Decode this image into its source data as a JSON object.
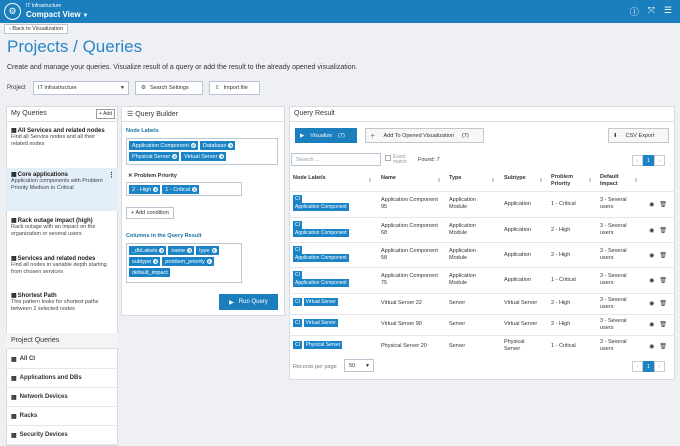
{
  "app": {
    "subtitle": "IT Infrastructure",
    "title": "Compact View"
  },
  "back_label": "Back to Visualization",
  "page": {
    "title": "Projects / Queries",
    "description": "Create and manage your queries. Visualize result of a query or add the result to the already opened visualization."
  },
  "project": {
    "label": "Project",
    "value": "IT Infrastructure",
    "search_settings": "Search Settings",
    "import_file": "Import file"
  },
  "my_queries": {
    "title": "My Queries",
    "add": "Add",
    "items": [
      {
        "name": "All Services and related nodes",
        "desc": "Find all Service nodes and all their related nodes"
      },
      {
        "name": "Core applications",
        "desc": "Application components with Problem Priority Medium to Critical"
      },
      {
        "name": "Rack outage impact (high)",
        "desc": "Rack outage with an impact on the organization or several users"
      },
      {
        "name": "Services and related nodes",
        "desc": "Find all nodes in variable depth starting from chosen services"
      },
      {
        "name": "Shortest Path",
        "desc": "This pattern looks for shortest paths between 2 selected nodes"
      }
    ]
  },
  "project_queries": {
    "title": "Project Queries",
    "items": [
      "All CI",
      "Applications and DBs",
      "Network Devices",
      "Racks",
      "Security Devices"
    ]
  },
  "builder": {
    "title": "Query Builder",
    "node_labels_title": "Node Labels",
    "node_labels": [
      "Application Component",
      "Database",
      "Physical Server",
      "Virtual Server"
    ],
    "problem_priority_title": "Problem Priority",
    "priorities": [
      "2 - High",
      "1 - Critical"
    ],
    "add_condition": "Add condition",
    "columns_title": "Columns in the Query Result",
    "columns": [
      "_dbLabels",
      "name",
      "type",
      "subtype",
      "problem_priority",
      "default_impact"
    ],
    "run": "Run Query"
  },
  "result": {
    "title": "Query Result",
    "visualize": "Visualize",
    "visualize_count": "(7)",
    "add_to_viz": "Add To Opened Visualization",
    "add_count": "(7)",
    "csv": "CSV Export",
    "search_placeholder": "Search ...",
    "exact": "Exact match",
    "found": "Found: 7",
    "page": "1",
    "columns": [
      "Node Labels",
      "Name",
      "Type",
      "Subtype",
      "Problem Priority",
      "Default Impact"
    ],
    "rows": [
      {
        "labels": [
          "CI",
          "Application Component"
        ],
        "name": "Application Component 95",
        "type": "Application Module",
        "subtype": "Application",
        "priority": "1 - Critical",
        "impact": "3 - Several users"
      },
      {
        "labels": [
          "CI",
          "Application Component"
        ],
        "name": "Application Component 68",
        "type": "Application Module",
        "subtype": "Application",
        "priority": "2 - High",
        "impact": "3 - Several users"
      },
      {
        "labels": [
          "CI",
          "Application Component"
        ],
        "name": "Application Component 58",
        "type": "Application Module",
        "subtype": "Application",
        "priority": "2 - High",
        "impact": "3 - Several users"
      },
      {
        "labels": [
          "CI",
          "Application Component"
        ],
        "name": "Application Component 75",
        "type": "Application Module",
        "subtype": "Application",
        "priority": "1 - Critical",
        "impact": "3 - Several users"
      },
      {
        "labels": [
          "CI",
          "Virtual Server"
        ],
        "name": "Virtual Server 22",
        "type": "Server",
        "subtype": "Virtual Server",
        "priority": "2 - High",
        "impact": "3 - Several users"
      },
      {
        "labels": [
          "CI",
          "Virtual Server"
        ],
        "name": "Virtual Server 90",
        "type": "Server",
        "subtype": "Virtual Server",
        "priority": "2 - High",
        "impact": "3 - Several users"
      },
      {
        "labels": [
          "CI",
          "Physical Server"
        ],
        "name": "Physical Server 20",
        "type": "Server",
        "subtype": "Physical Server",
        "priority": "1 - Critical",
        "impact": "3 - Several users"
      }
    ],
    "rows_per_page_label": "Records per page",
    "rows_per_page": "50"
  },
  "colors": {
    "primary": "#1b7fbd",
    "tag": "#1b84c7",
    "title": "#2a86c7"
  }
}
